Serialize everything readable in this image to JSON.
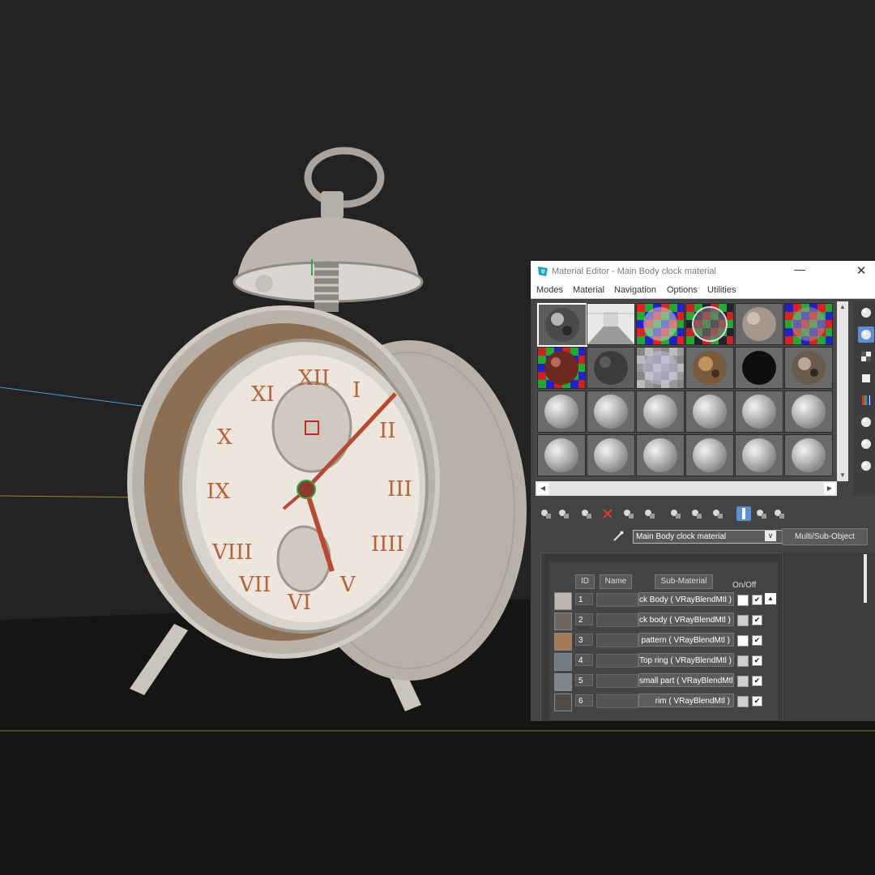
{
  "window": {
    "title": "Material Editor - Main Body clock material",
    "minimize_glyph": "—",
    "close_glyph": "✕"
  },
  "menu": {
    "items": [
      {
        "label": "Modes",
        "mnemonic": "o"
      },
      {
        "label": "Material",
        "mnemonic": "M"
      },
      {
        "label": "Navigation",
        "mnemonic": "N"
      },
      {
        "label": "Options",
        "mnemonic": "O"
      },
      {
        "label": "Utilities",
        "mnemonic": "U"
      }
    ]
  },
  "slots": {
    "rows": [
      [
        "metal-checker",
        "room-hdri",
        "checker-rgb",
        "checker-rgb-dark",
        "rough-stone",
        "checker-rgb-alt"
      ],
      [
        "red-checker",
        "dark-grey",
        "checker-grey",
        "rust-copper",
        "black",
        "rust-mixed"
      ],
      [
        "empty",
        "empty",
        "empty",
        "empty",
        "empty",
        "empty"
      ],
      [
        "empty",
        "empty",
        "empty",
        "empty",
        "empty",
        "empty"
      ]
    ],
    "active_index": 0
  },
  "side_tools": [
    {
      "icon": "sphere-sample-icon",
      "active": false
    },
    {
      "icon": "backlight-icon",
      "active": true
    },
    {
      "icon": "checker-background-icon",
      "active": false
    },
    {
      "icon": "sample-uv-icon",
      "active": false
    },
    {
      "icon": "video-color-check-icon",
      "active": false
    },
    {
      "icon": "make-preview-icon",
      "active": false
    },
    {
      "icon": "options-icon",
      "active": false
    },
    {
      "icon": "select-by-material-icon",
      "active": false
    }
  ],
  "toolbar": [
    {
      "icon": "get-material-icon",
      "active": false
    },
    {
      "icon": "put-to-scene-icon",
      "active": false
    },
    {
      "icon": "assign-to-selection-icon",
      "active": false
    },
    {
      "icon": "reset-map-icon",
      "active": false
    },
    {
      "icon": "copy-material-icon",
      "active": false
    },
    {
      "icon": "make-unique-icon",
      "active": false
    },
    {
      "icon": "put-to-library-icon",
      "active": false
    },
    {
      "icon": "material-id-channel-icon",
      "active": false
    },
    {
      "icon": "show-shaded-material-icon",
      "active": false
    },
    {
      "icon": "show-end-result-icon",
      "active": true
    },
    {
      "icon": "go-to-parent-icon",
      "active": false
    },
    {
      "icon": "go-forward-sibling-icon",
      "active": false
    }
  ],
  "material": {
    "name": "Main Body clock material",
    "type_button": "Multi/Sub-Object",
    "dropdown_glyph": "∨"
  },
  "submaterials": {
    "headers": {
      "id": "ID",
      "name": "Name",
      "sub_material": "Sub-Material",
      "on_off": "On/Off"
    },
    "rows": [
      {
        "id": "1",
        "name": "",
        "sub_material": "ck Body  ( VRayBlendMtl )",
        "color": "#ffffff",
        "checked": "✔",
        "thumb": "#bdb7ae"
      },
      {
        "id": "2",
        "name": "",
        "sub_material": "ck body  ( VRayBlendMtl )",
        "color": "#cfcfcf",
        "checked": "✔",
        "thumb": "#6d6660"
      },
      {
        "id": "3",
        "name": "",
        "sub_material": "pattern  ( VRayBlendMtl )",
        "color": "#ffffff",
        "checked": "✔",
        "thumb": "#a57a57"
      },
      {
        "id": "4",
        "name": "",
        "sub_material": "Top ring  ( VRayBlendMtl )",
        "color": "#d0d0d0",
        "checked": "✔",
        "thumb": "#6f7a82"
      },
      {
        "id": "5",
        "name": "",
        "sub_material": "small part  ( VRayBlendMtl )",
        "color": "#cfcfcf",
        "checked": "✔",
        "thumb": "#7e8790"
      },
      {
        "id": "6",
        "name": "",
        "sub_material": "rim  ( VRayBlendMtl )",
        "color": "#cfcfcf",
        "checked": "✔",
        "thumb": "#4e4b48"
      }
    ],
    "scroll_up_glyph": "▲"
  },
  "clock_face": {
    "numerals": [
      "XII",
      "I",
      "II",
      "III",
      "IIII",
      "V",
      "VI",
      "VII",
      "VIII",
      "IX",
      "X",
      "XI"
    ]
  },
  "colors": {
    "viewport_bg": "#232323",
    "floor": "#151515",
    "clock_body": "#c8c2bb",
    "numeral": "#b5623c",
    "hand": "#b84a32",
    "accent_blue": "#5d8fd6"
  }
}
